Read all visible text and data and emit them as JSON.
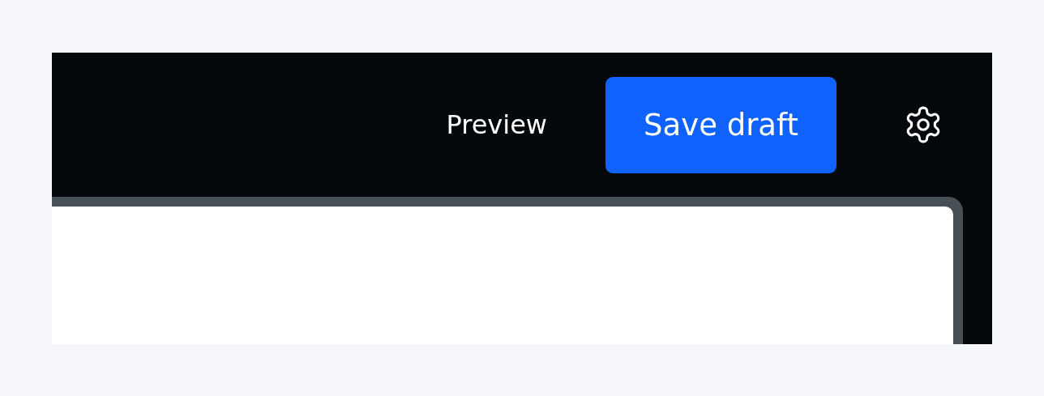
{
  "toolbar": {
    "preview": {
      "label": "Preview"
    },
    "save_button": {
      "label": "Save draft"
    }
  }
}
